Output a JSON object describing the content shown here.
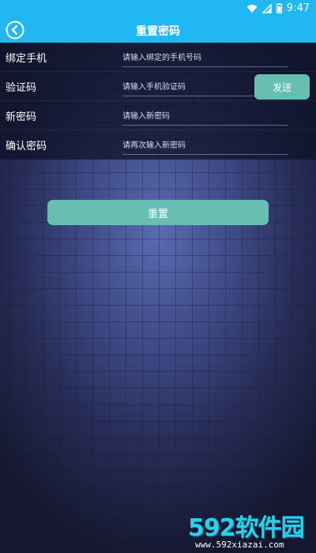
{
  "status_bar": {
    "time": "9:47",
    "icons": [
      "wifi-icon",
      "signal-icon",
      "battery-icon"
    ]
  },
  "app_bar": {
    "title": "重置密码",
    "back_icon": "back-arrow-icon"
  },
  "form": {
    "rows": [
      {
        "label": "绑定手机",
        "placeholder": "请输入绑定的手机号码"
      },
      {
        "label": "验证码",
        "placeholder": "请输入手机验证码"
      },
      {
        "label": "新密码",
        "placeholder": "请输入新密码"
      },
      {
        "label": "确认密码",
        "placeholder": "请再次输入新密码"
      }
    ],
    "send_button": "发送"
  },
  "reset_button": "重置",
  "watermark": {
    "logo": "592软件园",
    "url": "www.592xiazai.com"
  },
  "colors": {
    "accent_bar": "#21b7f2",
    "button": "#66bfb1",
    "watermark": "#29d2ea"
  }
}
